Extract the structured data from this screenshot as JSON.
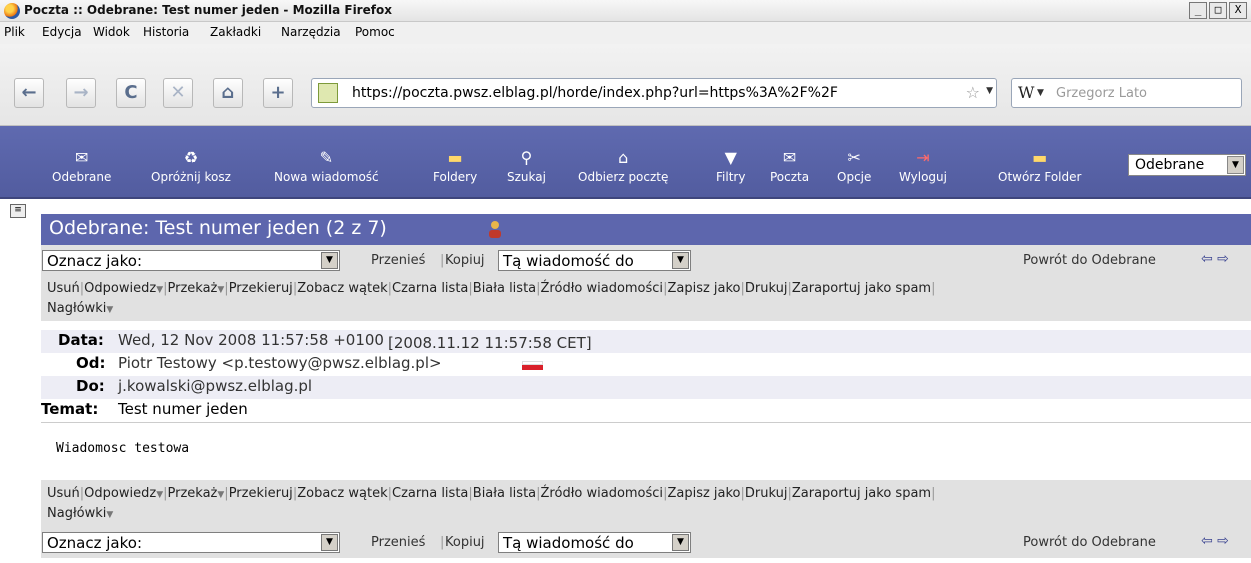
{
  "window": {
    "title": "Poczta :: Odebrane: Test numer jeden - Mozilla Firefox",
    "buttons": [
      "_",
      "□",
      "X"
    ]
  },
  "menu": [
    "Plik",
    "Edycja",
    "Widok",
    "Historia",
    "Zakładki",
    "Narzędzia",
    "Pomoc"
  ],
  "navbar": {
    "url": "https://poczta.pwsz.elblag.pl/horde/index.php?url=https%3A%2F%2F",
    "search_placeholder": "Grzegorz Lato",
    "search_engine": "W"
  },
  "horde_toolbar": {
    "items": [
      "Odebrane",
      "Opróżnij kosz",
      "Nowa wiadomość",
      "Foldery",
      "Szukaj",
      "Odbierz pocztę",
      "Filtry",
      "Poczta",
      "Opcje",
      "Wyloguj"
    ],
    "open_folder": "Otwórz Folder",
    "folder_select": "Odebrane"
  },
  "message": {
    "title": "Odebrane: Test numer jeden (2 z 7)",
    "mark_as": "Oznacz jako:",
    "move": "Przenieś",
    "copy": "Kopiuj",
    "target_select": "Tą wiadomość do",
    "back_link": "Powrót do Odebrane",
    "actions": [
      "Usuń",
      "Odpowiedz",
      "Przekaż",
      "Przekieruj",
      "Zobacz wątek",
      "Czarna lista",
      "Biała lista",
      "Źródło wiadomości",
      "Zapisz jako",
      "Drukuj",
      "Zaraportuj jako spam"
    ],
    "headers_toggle": "Nagłówki",
    "date_label": "Data:",
    "date_value": "Wed, 12 Nov 2008 11:57:58 +0100",
    "date_local": "[2008.11.12 11:57:58 CET]",
    "from_label": "Od:",
    "from_value": "Piotr Testowy <p.testowy@pwsz.elblag.pl>",
    "to_label": "Do:",
    "to_value": "j.kowalski@pwsz.elblag.pl",
    "subject_label": "Temat:",
    "subject_value": "Test numer jeden",
    "body": "Wiadomosc testowa"
  }
}
